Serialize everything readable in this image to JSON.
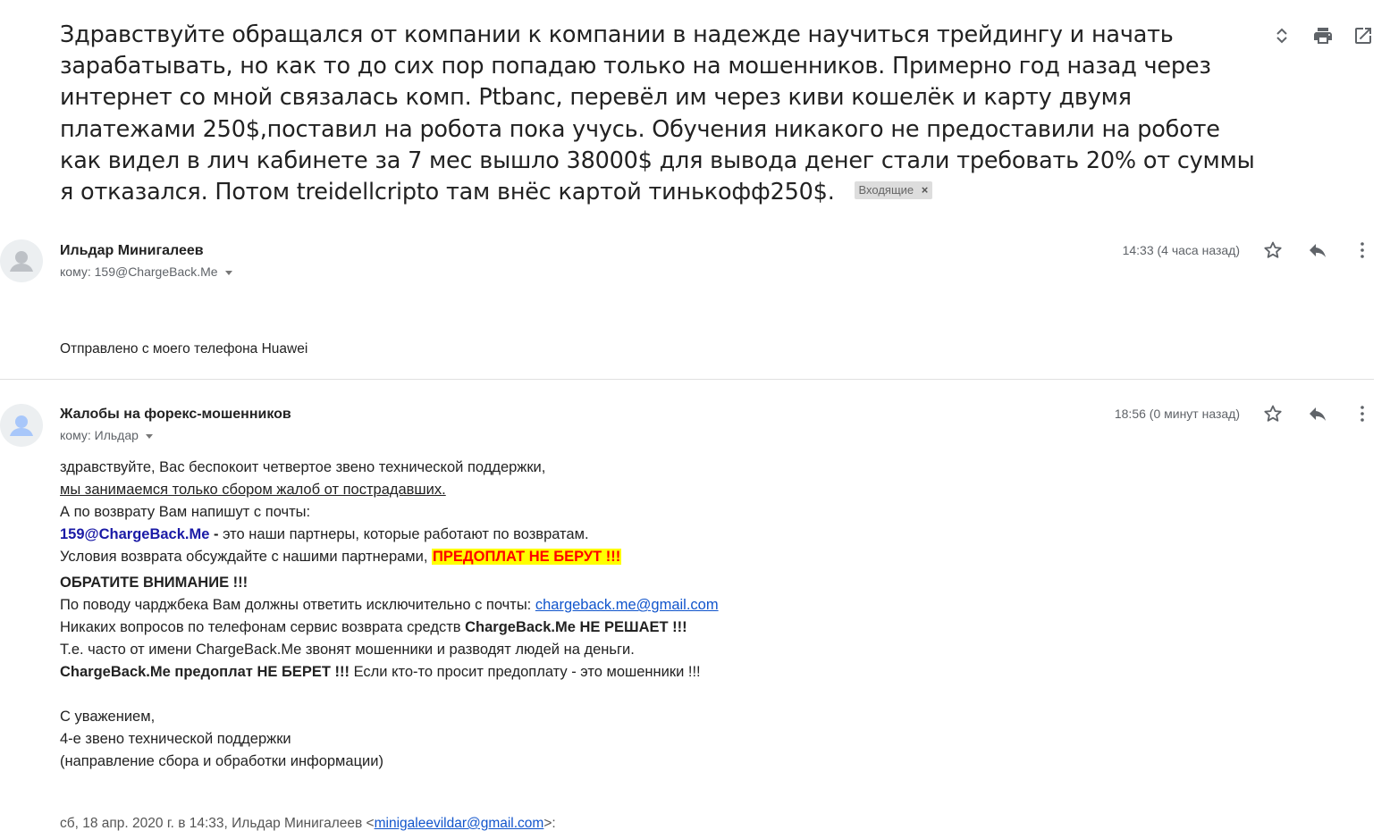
{
  "subject": {
    "text": "Здравствуйте обращался от компании к компании в надежде научиться трейдингу и начать зарабатывать, но как то до сих пор попадаю только на мошенников. Примерно год назад через интернет со мной связалась комп. Ptbanc, перевёл им через киви кошелёк и карту двумя платежами 250$,поставил на робота пока учусь. Обучения никакого не предоставили на роботе как видел в лич кабинете за 7 мес вышло 38000$ для вывода денег стали требовать 20% от суммы я отказался. Потом treidellcripto там внёс картой тинькофф250$.",
    "label": "Входящие",
    "label_remove": "×"
  },
  "top_icons": [
    "expand-collapse-icon",
    "print-icon",
    "open-in-new-window-icon"
  ],
  "messages": [
    {
      "sender": "Ильдар Минигалеев",
      "to": "кому: 159@ChargeBack.Me",
      "time": "14:33 (4 часа назад)",
      "body": "Отправлено с моего телефона Huawei"
    },
    {
      "sender": "Жалобы на форекс-мошенников",
      "to": "кому: Ильдар",
      "time": "18:56 (0 минут назад)",
      "lines": {
        "l1": "здравствуйте, Вас беспокоит четвертое звено технической поддержки,",
        "l2": "мы занимаемся только сбором жалоб от пострадавших.",
        "l3": "А по возврату Вам напишут с почты:",
        "l4_email": "159@ChargeBack.Me",
        "l4_dash": " - ",
        "l4_rest": "это наши партнеры, которые работают по возвратам.",
        "l5_text": "Условия возврата обсуждайте с нашими партнерами, ",
        "l5_warn": "ПРЕДОПЛАТ НЕ БЕРУТ !!!",
        "l6": "ОБРАТИТЕ ВНИМАНИЕ !!!",
        "l7_text": "По поводу чарджбека Вам должны ответить исключительно с почты: ",
        "l7_link": "chargeback.me@gmail.com",
        "l8_text": "Никаких вопросов по телефонам сервис возврата средств ",
        "l8_bold": "ChargeBack.Me НЕ РЕШАЕТ !!!",
        "l9": "Т.е. часто от имени ChargeBack.Me звонят мошенники и разводят людей на деньги.",
        "l10_bold": "ChargeBack.Me предоплат НЕ БЕРЕТ !!!",
        "l10_text": " Если кто-то просит предоплату - это мошенники !!!",
        "sig1": "С уважением,",
        "sig2": "4-е звено технической поддержки",
        "sig3": "(направление сбора и обработки информации)"
      },
      "quote": {
        "prefix": "сб, 18 апр. 2020 г. в 14:33, Ильдар Минигалеев <",
        "email": "minigaleevildar@gmail.com",
        "suffix": ">:"
      }
    }
  ],
  "message_icons": [
    "star-icon",
    "reply-icon",
    "more-vert-icon"
  ]
}
